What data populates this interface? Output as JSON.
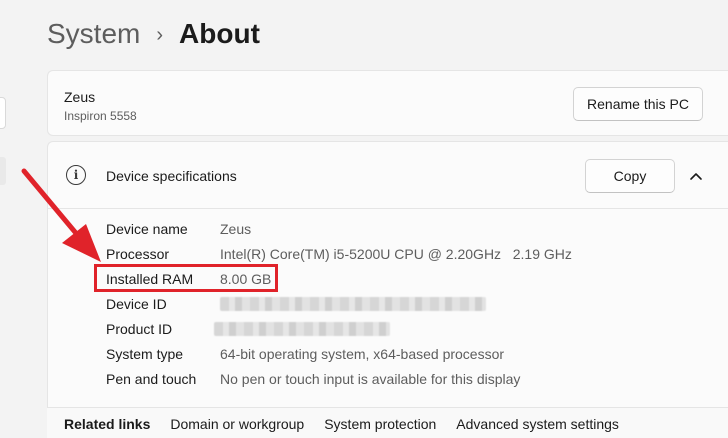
{
  "breadcrumb": {
    "parent": "System",
    "separator": "›",
    "current": "About"
  },
  "device": {
    "name": "Zeus",
    "model": "Inspiron 5558",
    "rename_label": "Rename this PC"
  },
  "specs": {
    "title": "Device specifications",
    "copy_label": "Copy",
    "rows": [
      {
        "label": "Device name",
        "value": "Zeus"
      },
      {
        "label": "Processor",
        "value": "Intel(R) Core(TM) i5-5200U CPU @ 2.20GHz   2.19 GHz"
      },
      {
        "label": "Installed RAM",
        "value": "8.00 GB"
      },
      {
        "label": "Device ID",
        "value": ""
      },
      {
        "label": "Product ID",
        "value": ""
      },
      {
        "label": "System type",
        "value": "64-bit operating system, x64-based processor"
      },
      {
        "label": "Pen and touch",
        "value": "No pen or touch input is available for this display"
      }
    ]
  },
  "related": {
    "title": "Related links",
    "links": [
      "Domain or workgroup",
      "System protection",
      "Advanced system settings"
    ]
  },
  "icons": {
    "info": "info-icon",
    "chevron": "chevron-up-icon",
    "breadcrumb_separator": "chevron-right-icon"
  },
  "annotation_color": "#e0232a"
}
